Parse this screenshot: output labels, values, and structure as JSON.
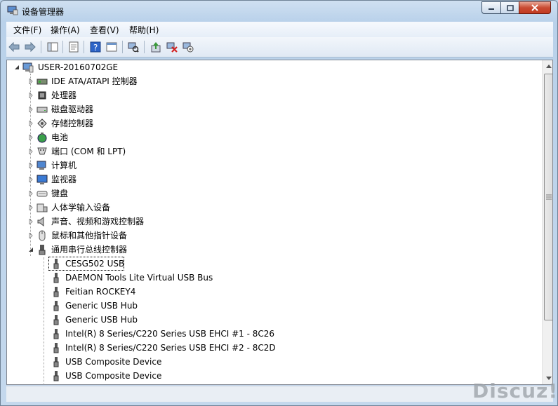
{
  "window": {
    "title": "设备管理器"
  },
  "menu": [
    "文件(F)",
    "操作(A)",
    "查看(V)",
    "帮助(H)"
  ],
  "toolbar": {
    "buttons": [
      "back-icon",
      "forward-icon",
      "show-hide-tree-icon",
      "properties-icon",
      "help-icon",
      "view-icon",
      "scan-hardware-icon",
      "update-driver-icon",
      "uninstall-icon",
      "disable-icon"
    ]
  },
  "tree": {
    "root": "USER-20160702GE",
    "categories": [
      "IDE ATA/ATAPI 控制器",
      "处理器",
      "磁盘驱动器",
      "存储控制器",
      "电池",
      "端口 (COM 和 LPT)",
      "计算机",
      "监视器",
      "键盘",
      "人体学输入设备",
      "声音、视频和游戏控制器",
      "鼠标和其他指针设备",
      "通用串行总线控制器"
    ],
    "usb_devices": [
      "CESG502 USB",
      "DAEMON Tools Lite Virtual USB Bus",
      "Feitian ROCKEY4",
      "Generic USB Hub",
      "Generic USB Hub",
      "Intel(R) 8 Series/C220 Series USB EHCI #1 - 8C26",
      "Intel(R) 8 Series/C220 Series USB EHCI #2 - 8C2D",
      "USB Composite Device",
      "USB Composite Device"
    ]
  },
  "watermark": "Discuz!"
}
